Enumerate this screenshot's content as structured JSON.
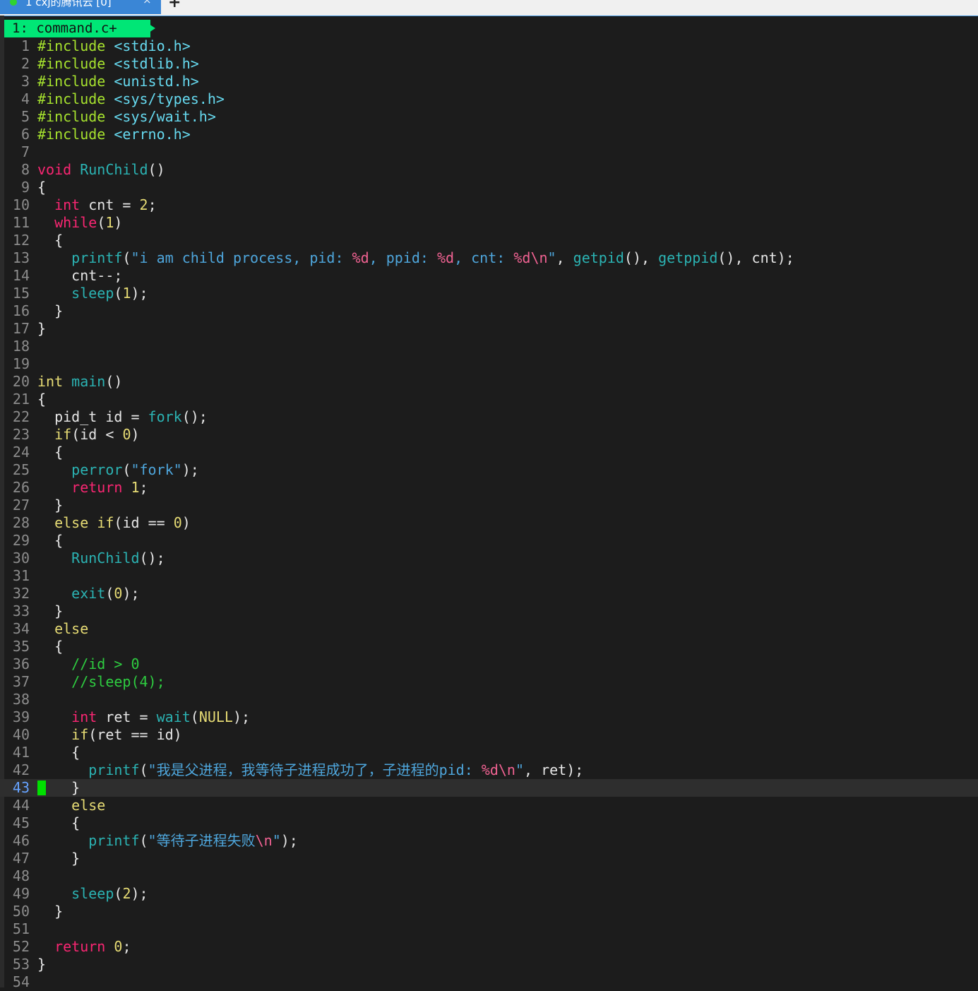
{
  "tab": {
    "title": "1 cxj的腾讯云 [0]",
    "close_glyph": "×",
    "add_glyph": "+"
  },
  "buffer": {
    "label": "1: command.c+"
  },
  "editor": {
    "current_line": 43
  },
  "lines": [
    [
      [
        "pp",
        "#include "
      ],
      [
        "inc",
        "<stdio.h>"
      ]
    ],
    [
      [
        "pp",
        "#include "
      ],
      [
        "inc",
        "<stdlib.h>"
      ]
    ],
    [
      [
        "pp",
        "#include "
      ],
      [
        "inc",
        "<unistd.h>"
      ]
    ],
    [
      [
        "pp",
        "#include "
      ],
      [
        "inc",
        "<sys/types.h>"
      ]
    ],
    [
      [
        "pp",
        "#include "
      ],
      [
        "inc",
        "<sys/wait.h>"
      ]
    ],
    [
      [
        "pp",
        "#include "
      ],
      [
        "inc",
        "<errno.h>"
      ]
    ],
    [],
    [
      [
        "kw",
        "void"
      ],
      [
        "pl",
        " "
      ],
      [
        "fn",
        "RunChild"
      ],
      [
        "pl",
        "()"
      ]
    ],
    [
      [
        "pl",
        "{"
      ]
    ],
    [
      [
        "pl",
        "  "
      ],
      [
        "kw",
        "int"
      ],
      [
        "pl",
        " cnt = "
      ],
      [
        "num",
        "2"
      ],
      [
        "pl",
        ";"
      ]
    ],
    [
      [
        "pl",
        "  "
      ],
      [
        "kw",
        "while"
      ],
      [
        "pl",
        "("
      ],
      [
        "num",
        "1"
      ],
      [
        "pl",
        ")"
      ]
    ],
    [
      [
        "pl",
        "  {"
      ]
    ],
    [
      [
        "pl",
        "    "
      ],
      [
        "fn",
        "printf"
      ],
      [
        "pl",
        "("
      ],
      [
        "str",
        "\"i am child process, pid: "
      ],
      [
        "fmt",
        "%d"
      ],
      [
        "str",
        ", ppid: "
      ],
      [
        "fmt",
        "%d"
      ],
      [
        "str",
        ", cnt: "
      ],
      [
        "fmt",
        "%d\\n"
      ],
      [
        "str",
        "\""
      ],
      [
        "pl",
        ", "
      ],
      [
        "fn",
        "getpid"
      ],
      [
        "pl",
        "(), "
      ],
      [
        "fn",
        "getppid"
      ],
      [
        "pl",
        "(), cnt);"
      ]
    ],
    [
      [
        "pl",
        "    cnt--;"
      ]
    ],
    [
      [
        "pl",
        "    "
      ],
      [
        "fn",
        "sleep"
      ],
      [
        "pl",
        "("
      ],
      [
        "num",
        "1"
      ],
      [
        "pl",
        ");"
      ]
    ],
    [
      [
        "pl",
        "  }"
      ]
    ],
    [
      [
        "pl",
        "}"
      ]
    ],
    [],
    [],
    [
      [
        "kw2",
        "int"
      ],
      [
        "pl",
        " "
      ],
      [
        "fn",
        "main"
      ],
      [
        "pl",
        "()"
      ]
    ],
    [
      [
        "pl",
        "{"
      ]
    ],
    [
      [
        "pl",
        "  pid_t id = "
      ],
      [
        "fn",
        "fork"
      ],
      [
        "pl",
        "();"
      ]
    ],
    [
      [
        "pl",
        "  "
      ],
      [
        "kw2",
        "if"
      ],
      [
        "pl",
        "(id < "
      ],
      [
        "num",
        "0"
      ],
      [
        "pl",
        ")"
      ]
    ],
    [
      [
        "pl",
        "  {"
      ]
    ],
    [
      [
        "pl",
        "    "
      ],
      [
        "fn",
        "perror"
      ],
      [
        "pl",
        "("
      ],
      [
        "str",
        "\"fork\""
      ],
      [
        "pl",
        ");"
      ]
    ],
    [
      [
        "pl",
        "    "
      ],
      [
        "kw",
        "return"
      ],
      [
        "pl",
        " "
      ],
      [
        "num",
        "1"
      ],
      [
        "pl",
        ";"
      ]
    ],
    [
      [
        "pl",
        "  }"
      ]
    ],
    [
      [
        "pl",
        "  "
      ],
      [
        "kw2",
        "else"
      ],
      [
        "pl",
        " "
      ],
      [
        "kw2",
        "if"
      ],
      [
        "pl",
        "(id == "
      ],
      [
        "num",
        "0"
      ],
      [
        "pl",
        ")"
      ]
    ],
    [
      [
        "pl",
        "  {"
      ]
    ],
    [
      [
        "pl",
        "    "
      ],
      [
        "fn",
        "RunChild"
      ],
      [
        "pl",
        "();"
      ]
    ],
    [],
    [
      [
        "pl",
        "    "
      ],
      [
        "fn",
        "exit"
      ],
      [
        "pl",
        "("
      ],
      [
        "num",
        "0"
      ],
      [
        "pl",
        ");"
      ]
    ],
    [
      [
        "pl",
        "  }"
      ]
    ],
    [
      [
        "pl",
        "  "
      ],
      [
        "kw2",
        "else"
      ]
    ],
    [
      [
        "pl",
        "  {"
      ]
    ],
    [
      [
        "pl",
        "    "
      ],
      [
        "com",
        "//id > 0"
      ]
    ],
    [
      [
        "pl",
        "    "
      ],
      [
        "com",
        "//sleep(4);"
      ]
    ],
    [],
    [
      [
        "pl",
        "    "
      ],
      [
        "kw",
        "int"
      ],
      [
        "pl",
        " ret = "
      ],
      [
        "fn",
        "wait"
      ],
      [
        "pl",
        "("
      ],
      [
        "num",
        "NULL"
      ],
      [
        "pl",
        ");"
      ]
    ],
    [
      [
        "pl",
        "    "
      ],
      [
        "kw2",
        "if"
      ],
      [
        "pl",
        "(ret == id)"
      ]
    ],
    [
      [
        "pl",
        "    {"
      ]
    ],
    [
      [
        "pl",
        "      "
      ],
      [
        "fn",
        "printf"
      ],
      [
        "pl",
        "("
      ],
      [
        "str",
        "\"我是父进程，我等待子进程成功了，子进程的pid: "
      ],
      [
        "fmt",
        "%d\\n"
      ],
      [
        "str",
        "\""
      ],
      [
        "pl",
        ", ret);"
      ]
    ],
    [
      [
        "pl",
        "    }"
      ]
    ],
    [
      [
        "pl",
        "    "
      ],
      [
        "kw2",
        "else"
      ]
    ],
    [
      [
        "pl",
        "    {"
      ]
    ],
    [
      [
        "pl",
        "      "
      ],
      [
        "fn",
        "printf"
      ],
      [
        "pl",
        "("
      ],
      [
        "str",
        "\"等待子进程失败"
      ],
      [
        "fmt",
        "\\n"
      ],
      [
        "str",
        "\""
      ],
      [
        "pl",
        ");"
      ]
    ],
    [
      [
        "pl",
        "    }"
      ]
    ],
    [],
    [
      [
        "pl",
        "    "
      ],
      [
        "fn",
        "sleep"
      ],
      [
        "pl",
        "("
      ],
      [
        "num",
        "2"
      ],
      [
        "pl",
        ");"
      ]
    ],
    [
      [
        "pl",
        "  }"
      ]
    ],
    [],
    [
      [
        "pl",
        "  "
      ],
      [
        "kw",
        "return"
      ],
      [
        "pl",
        " "
      ],
      [
        "num",
        "0"
      ],
      [
        "pl",
        ";"
      ]
    ],
    [
      [
        "pl",
        "}"
      ]
    ],
    []
  ]
}
